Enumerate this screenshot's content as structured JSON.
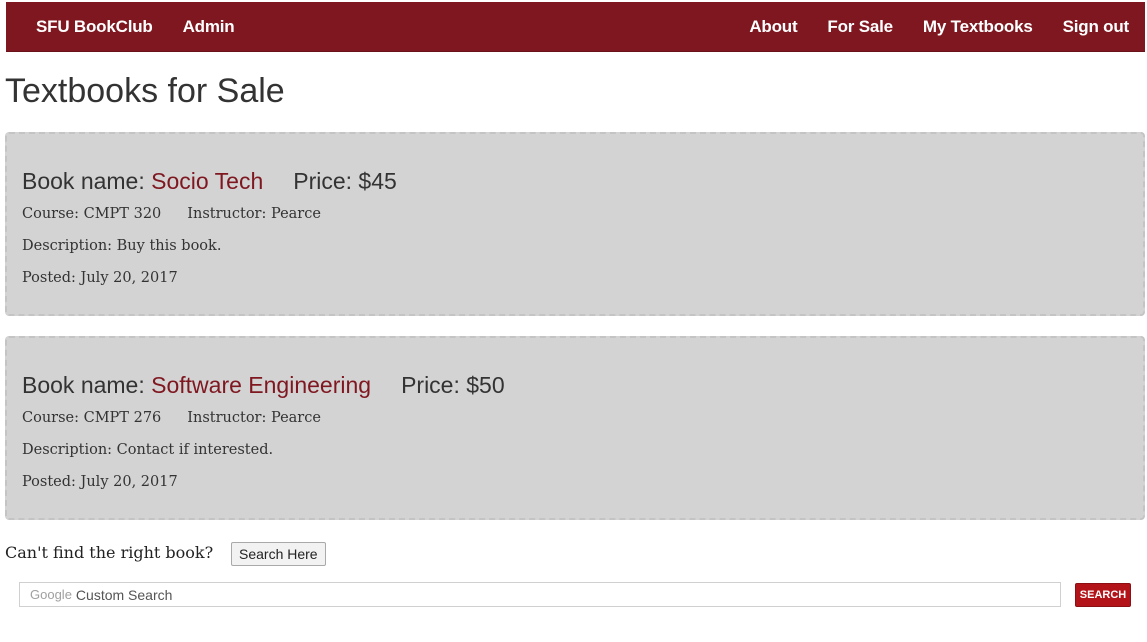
{
  "nav": {
    "brand": "SFU BookClub",
    "admin": "Admin",
    "about": "About",
    "for_sale": "For Sale",
    "my_textbooks": "My Textbooks",
    "sign_out": "Sign out"
  },
  "page_title": "Textbooks for Sale",
  "listings": [
    {
      "book_label": "Book name: ",
      "book_name": "Socio Tech",
      "price_label": "Price: $45",
      "course": "Course: CMPT 320",
      "instructor": "Instructor: Pearce",
      "description": "Description: Buy this book.",
      "posted": "Posted: July 20, 2017"
    },
    {
      "book_label": "Book name: ",
      "book_name": "Software Engineering",
      "price_label": "Price: $50",
      "course": "Course: CMPT 276",
      "instructor": "Instructor: Pearce",
      "description": "Description: Contact if interested.",
      "posted": "Posted: July 20, 2017"
    }
  ],
  "search": {
    "prompt": "Can't find the right book?",
    "search_here_label": "Search Here",
    "google_label": "Google",
    "custom_search_label": "Custom Search",
    "button_label": "SEARCH"
  },
  "colors": {
    "navbar": "#7f1720",
    "book_link": "#7f1720",
    "card_bg": "#d3d3d3",
    "search_button": "#b3141a"
  }
}
